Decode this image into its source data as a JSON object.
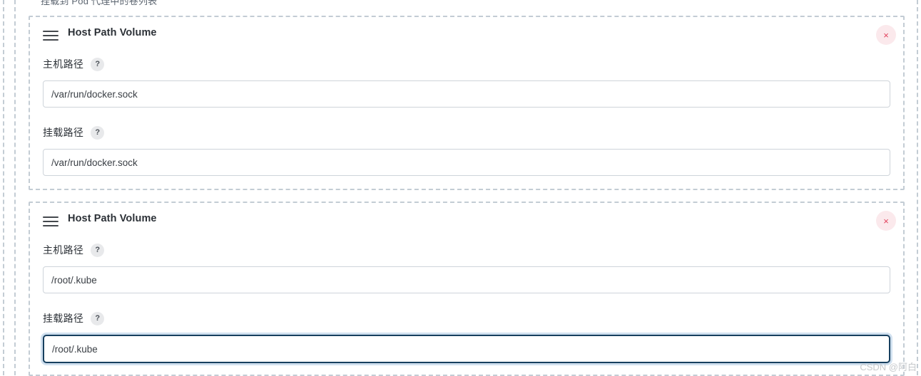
{
  "page": {
    "top_description": "挂载到 Pod 代理中的卷列表",
    "watermark": "CSDN @阿白"
  },
  "icons": {
    "drag_handle": "hamburger-icon",
    "close": "×",
    "help": "?"
  },
  "colors": {
    "dashed_border": "#c3ccd4",
    "input_border": "#ced4da",
    "input_focus_border": "#173f5f",
    "close_bg": "#fbe9ec",
    "close_fg": "#e2415c",
    "help_bg": "#e8e9eb",
    "watermark": "#c6c9cc"
  },
  "cards": [
    {
      "title": "Host Path Volume",
      "close_label": "×",
      "fields": [
        {
          "label": "主机路径",
          "help": "?",
          "value": "/var/run/docker.sock",
          "placeholder": "/var/run/docker.sock",
          "focused": false
        },
        {
          "label": "挂载路径",
          "help": "?",
          "value": "/var/run/docker.sock",
          "placeholder": "/var/run/docker.sock",
          "focused": false
        }
      ]
    },
    {
      "title": "Host Path Volume",
      "close_label": "×",
      "fields": [
        {
          "label": "主机路径",
          "help": "?",
          "value": "/root/.kube",
          "placeholder": "/root/.kube",
          "focused": false
        },
        {
          "label": "挂载路径",
          "help": "?",
          "value": "/root/.kube",
          "placeholder": "/root/.kube",
          "focused": true
        }
      ]
    }
  ]
}
